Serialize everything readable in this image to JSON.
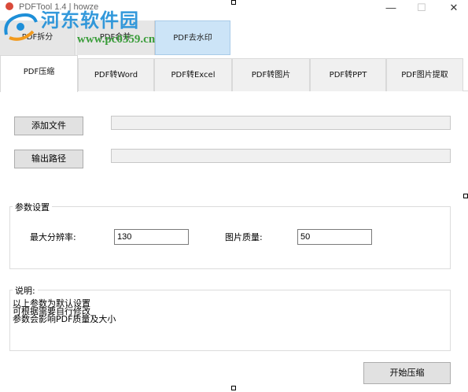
{
  "window": {
    "title": "PDFTool 1.4 | howze",
    "minimize": "—",
    "maximize": "☐",
    "close": "✕"
  },
  "watermark": {
    "name": "河东软件园",
    "url": "www.pc0359.cn"
  },
  "top_tabs": [
    "PDF拆分",
    "PDF合并",
    "PDF去水印"
  ],
  "sub_tabs": [
    "PDF压缩",
    "PDF转Word",
    "PDF转Excel",
    "PDF转图片",
    "PDF转PPT",
    "PDF图片提取"
  ],
  "actions": {
    "add_file": "添加文件",
    "output_path": "输出路径",
    "start": "开始压缩"
  },
  "settings": {
    "group_label": "参数设置",
    "max_resolution_label": "最大分辨率:",
    "max_resolution_value": "130",
    "image_quality_label": "图片质量:",
    "image_quality_value": "50"
  },
  "description": {
    "group_label": "说明:",
    "lines": [
      "以上参数为默认设置",
      "可根据需要自行修改",
      "参数会影响PDF质量及大小"
    ]
  }
}
